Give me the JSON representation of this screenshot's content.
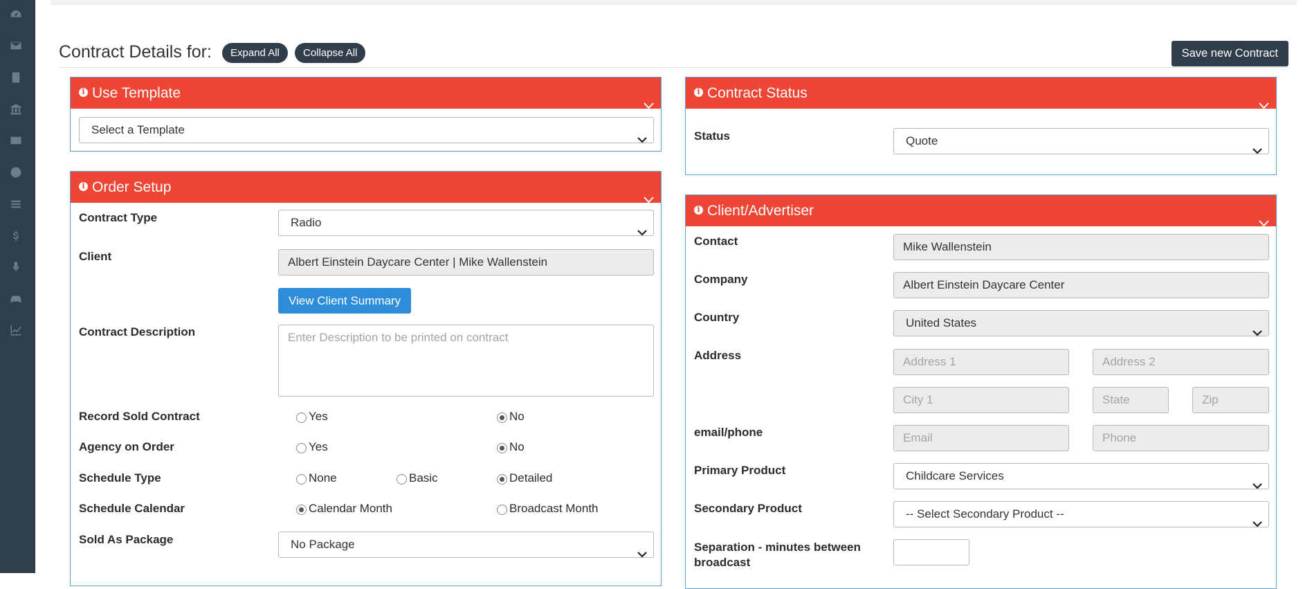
{
  "sidebar": {
    "icons": [
      "dashboard-icon",
      "envelope-icon",
      "building-icon",
      "bank-icon",
      "id-card-icon",
      "user-circle-icon",
      "list-icon",
      "dollar-icon",
      "microphone-icon",
      "car-icon",
      "chart-line-icon"
    ]
  },
  "header": {
    "title": "Contract Details for:",
    "expand_all": "Expand All",
    "collapse_all": "Collapse All",
    "save_button": "Save new Contract"
  },
  "use_template": {
    "title": "Use Template",
    "select_value": "Select a Template"
  },
  "order_setup": {
    "title": "Order Setup",
    "contract_type_label": "Contract Type",
    "contract_type_value": "Radio",
    "client_label": "Client",
    "client_value": "Albert Einstein Daycare Center | Mike Wallenstein",
    "view_client_summary": "View Client Summary",
    "description_label": "Contract Description",
    "description_placeholder": "Enter Description to be printed on contract",
    "record_sold_label": "Record Sold Contract",
    "agency_label": "Agency on Order",
    "yes": "Yes",
    "no": "No",
    "schedule_type_label": "Schedule Type",
    "schedule_type_none": "None",
    "schedule_type_basic": "Basic",
    "schedule_type_detailed": "Detailed",
    "schedule_calendar_label": "Schedule Calendar",
    "calendar_month": "Calendar Month",
    "broadcast_month": "Broadcast Month",
    "sold_as_package_label": "Sold As Package",
    "sold_as_package_value": "No Package"
  },
  "contract_status": {
    "title": "Contract Status",
    "status_label": "Status",
    "status_value": "Quote"
  },
  "client_advertiser": {
    "title": "Client/Advertiser",
    "contact_label": "Contact",
    "contact_value": "Mike Wallenstein",
    "company_label": "Company",
    "company_value": "Albert Einstein Daycare Center",
    "country_label": "Country",
    "country_value": "United States",
    "address_label": "Address",
    "address1_placeholder": "Address 1",
    "address2_placeholder": "Address 2",
    "city_placeholder": "City 1",
    "state_placeholder": "State",
    "zip_placeholder": "Zip",
    "email_phone_label": "email/phone",
    "email_placeholder": "Email",
    "phone_placeholder": "Phone",
    "primary_product_label": "Primary Product",
    "primary_product_value": "Childcare Services",
    "secondary_product_label": "Secondary Product",
    "secondary_product_value": "-- Select Secondary Product --",
    "separation_label_line1": "Separation - minutes between",
    "separation_label_line2": "broadcast",
    "separation_value": ""
  },
  "colors": {
    "sidebar_bg": "#2f3e4a",
    "panel_header": "#ef4535",
    "panel_border": "#5ba3d9",
    "primary_button": "#2e8ddb"
  }
}
